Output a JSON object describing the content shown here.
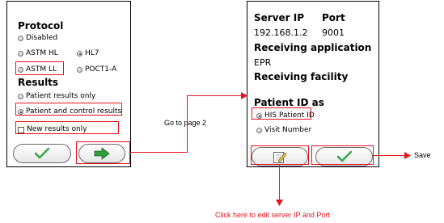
{
  "left_panel": {
    "protocol_heading": "Protocol",
    "protocol_options": {
      "disabled": "Disabled",
      "astm_hl": "ASTM HL",
      "hl7": "HL7",
      "astm_ll": "ASTM LL",
      "poct1a": "POCT1-A"
    },
    "results_heading": "Results",
    "results_options": {
      "patient_only": "Patient results only",
      "patient_control": "Patient and control results"
    },
    "new_results_only": "New results only"
  },
  "right_panel": {
    "server_ip_label": "Server IP",
    "port_label": "Port",
    "server_ip_value": "192.168.1.2",
    "port_value": "9001",
    "receiving_application_label": "Receiving application",
    "receiving_application_value": "EPR",
    "receiving_facility_label": "Receiving facility",
    "patient_id_heading": "Patient ID as",
    "patient_id_options": {
      "his": "HIS Patient ID",
      "visit": "Visit Number"
    }
  },
  "annotations": {
    "go_to_page_2": "Go to page 2",
    "save": "Save",
    "edit_hint": "Click here to edit server IP and Port"
  },
  "colors": {
    "annotation_red": "#e4141e",
    "check_green": "#3aa84a",
    "arrow_green": "#2f9e3b"
  },
  "icons": {
    "confirm": "checkmark-icon",
    "next": "right-arrow-icon",
    "edit": "edit-note-icon"
  }
}
